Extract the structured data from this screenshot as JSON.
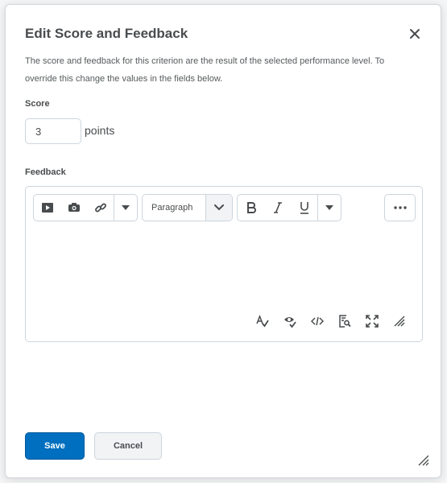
{
  "dialog": {
    "title": "Edit Score and Feedback",
    "description": "The score and feedback for this criterion are the result of the selected performance level. To override this change the values in the fields below.",
    "score_label": "Score",
    "score_value": "3",
    "points_label": "points",
    "feedback_label": "Feedback",
    "save_label": "Save",
    "cancel_label": "Cancel"
  },
  "editor": {
    "format_selected": "Paragraph",
    "toolbar_icons": [
      "video-icon",
      "camera-icon",
      "link-icon",
      "chevron-down-icon",
      "bold-icon",
      "italic-icon",
      "underline-icon",
      "more-icon"
    ],
    "footer_icons": [
      "spellcheck-icon",
      "accessibility-check-icon",
      "source-code-icon",
      "preview-icon",
      "fullscreen-icon",
      "resize-handle-icon"
    ]
  },
  "colors": {
    "primary": "#006fbf",
    "text": "#494c4e",
    "border": "#cdd5dc"
  }
}
